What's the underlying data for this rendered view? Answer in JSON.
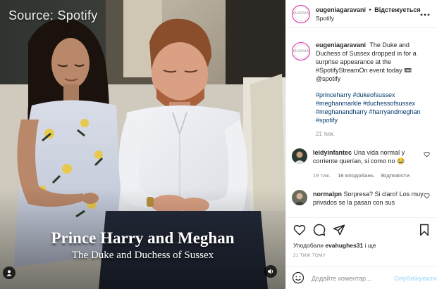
{
  "media": {
    "source_label": "Source: Spotify",
    "caption_main": "Prince Harry and Meghan",
    "caption_sub": "The Duke and Duchess of Sussex",
    "tag_icon": "user-tag-icon",
    "sound_icon": "speaker-icon"
  },
  "header": {
    "username": "eugeniagaravani",
    "separator": "•",
    "follow_label": "Відстежується",
    "location": "Spotify",
    "more_icon": "more-icon",
    "avatar_text": "EUGENIA"
  },
  "caption": {
    "username": "eugeniagaravani",
    "text": "The Duke and Duchess of Sussex dropped in for a surprise appearance at the #SpotifyStreamOn event today 📼 @spotify",
    "hashtags": "#princeharry #dukeofsussex #meghanmarkle #duchessofsussex #meghanandharry #harryandmeghan #spotify",
    "time": "21 тиж."
  },
  "comments": [
    {
      "username": "leidyinfantec",
      "text": "Una vida normal y corriente querían, si como no 😂",
      "time": "19 тиж.",
      "likes": "16 вподобань",
      "reply": "Відповісти",
      "avatar_color": "#2b3a2f"
    },
    {
      "username": "normalpn",
      "text": "Sorpresa? Si claro! Los muy privados se la pasan con sus",
      "avatar_color": "#6b6b5b"
    }
  ],
  "actions": {
    "like_icon": "heart-icon",
    "comment_icon": "comment-icon",
    "share_icon": "share-icon",
    "save_icon": "bookmark-icon",
    "likes_prefix": "Уподобали",
    "likes_user": "evahughes31",
    "likes_suffix": "і ще",
    "timestamp": "21 ТИЖ ТОМУ"
  },
  "add_comment": {
    "emoji_icon": "emoji-icon",
    "placeholder": "Додайте коментар...",
    "publish_label": "Опублікувати"
  }
}
